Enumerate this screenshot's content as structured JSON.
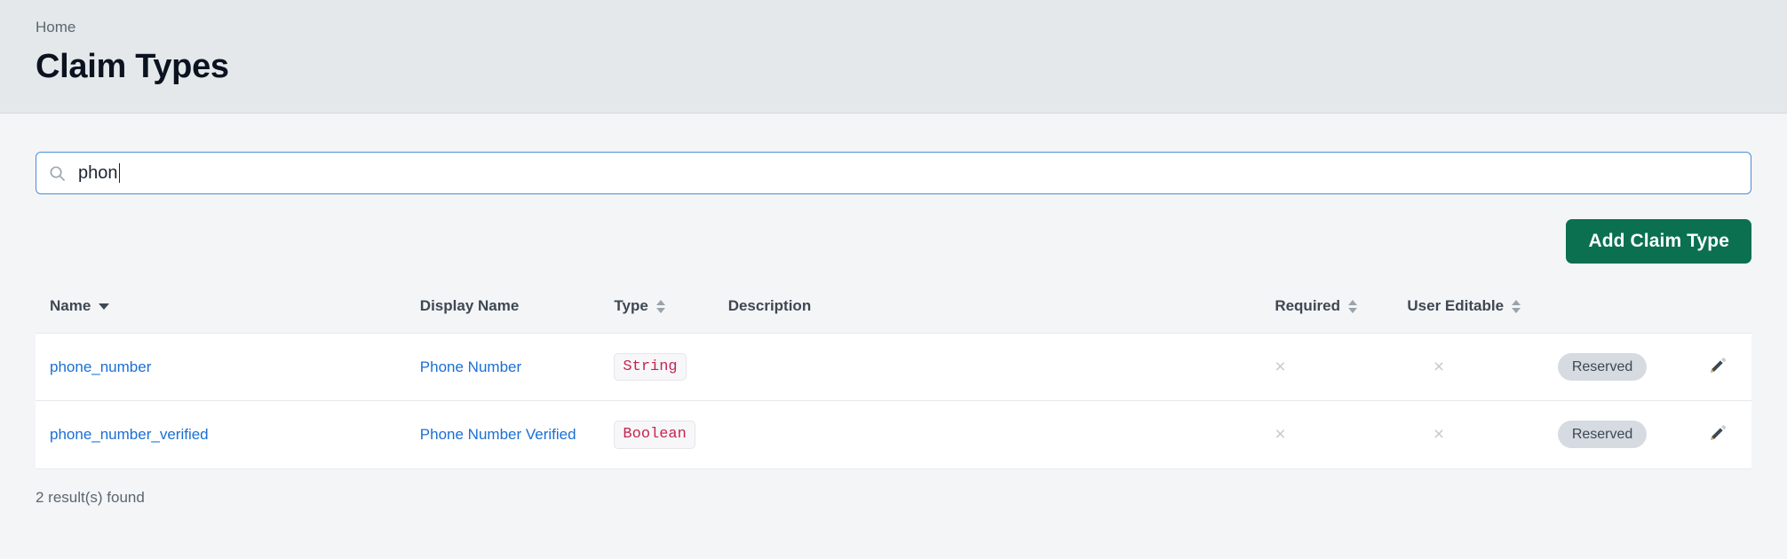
{
  "header": {
    "breadcrumb": "Home",
    "title": "Claim Types"
  },
  "search": {
    "icon": "search-icon",
    "value": "phon",
    "placeholder": "Search"
  },
  "toolbar": {
    "add_label": "Add Claim Type"
  },
  "table": {
    "columns": [
      {
        "label": "Name",
        "sort": "active-desc"
      },
      {
        "label": "Display Name",
        "sort": "none"
      },
      {
        "label": "Type",
        "sort": "idle"
      },
      {
        "label": "Description",
        "sort": "none"
      },
      {
        "label": "Required",
        "sort": "idle"
      },
      {
        "label": "User Editable",
        "sort": "idle"
      }
    ],
    "rows": [
      {
        "name": "phone_number",
        "display_name": "Phone Number",
        "type": "String",
        "description": "",
        "required": "×",
        "user_editable": "×",
        "badge": "Reserved",
        "edit_icon": "pencil-icon"
      },
      {
        "name": "phone_number_verified",
        "display_name": "Phone Number Verified",
        "type": "Boolean",
        "description": "",
        "required": "×",
        "user_editable": "×",
        "badge": "Reserved",
        "edit_icon": "pencil-icon"
      }
    ]
  },
  "footer": {
    "results": "2 result(s) found"
  },
  "colors": {
    "header_band": "#e4e8ea",
    "body": "#f4f5f7",
    "accent_green": "#0a7050",
    "link_blue": "#1a6fd4",
    "focus_blue": "#4a90d9",
    "code_red": "#c7254e",
    "badge_gray": "#d6dae1"
  }
}
